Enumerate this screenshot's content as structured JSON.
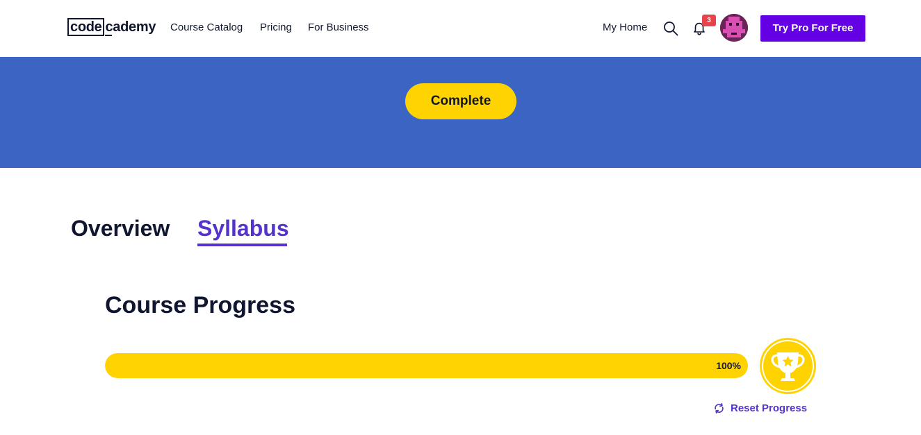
{
  "header": {
    "logo": {
      "boxed": "code",
      "rest": "cademy"
    },
    "nav": [
      {
        "label": "Course Catalog"
      },
      {
        "label": "Pricing"
      },
      {
        "label": "For Business"
      }
    ],
    "my_home": "My Home",
    "notifications_count": "3",
    "try_pro_label": "Try Pro For Free",
    "icons": {
      "search": "search-icon",
      "bell": "bell-icon",
      "avatar": "avatar"
    }
  },
  "hero": {
    "complete_label": "Complete"
  },
  "tabs": [
    {
      "label": "Overview",
      "active": false
    },
    {
      "label": "Syllabus",
      "active": true
    }
  ],
  "progress": {
    "title": "Course Progress",
    "percent_label": "100%",
    "percent_value": 1.0,
    "reset_label": "Reset Progress",
    "icons": {
      "trophy": "trophy-icon",
      "reset": "refresh-icon"
    }
  },
  "colors": {
    "hero_blue": "#3c65c3",
    "accent_yellow": "#ffd300",
    "brand_purple": "#6400e4",
    "tab_purple": "#5533cc",
    "badge_red": "#e8434a",
    "text_dark": "#10162f"
  }
}
